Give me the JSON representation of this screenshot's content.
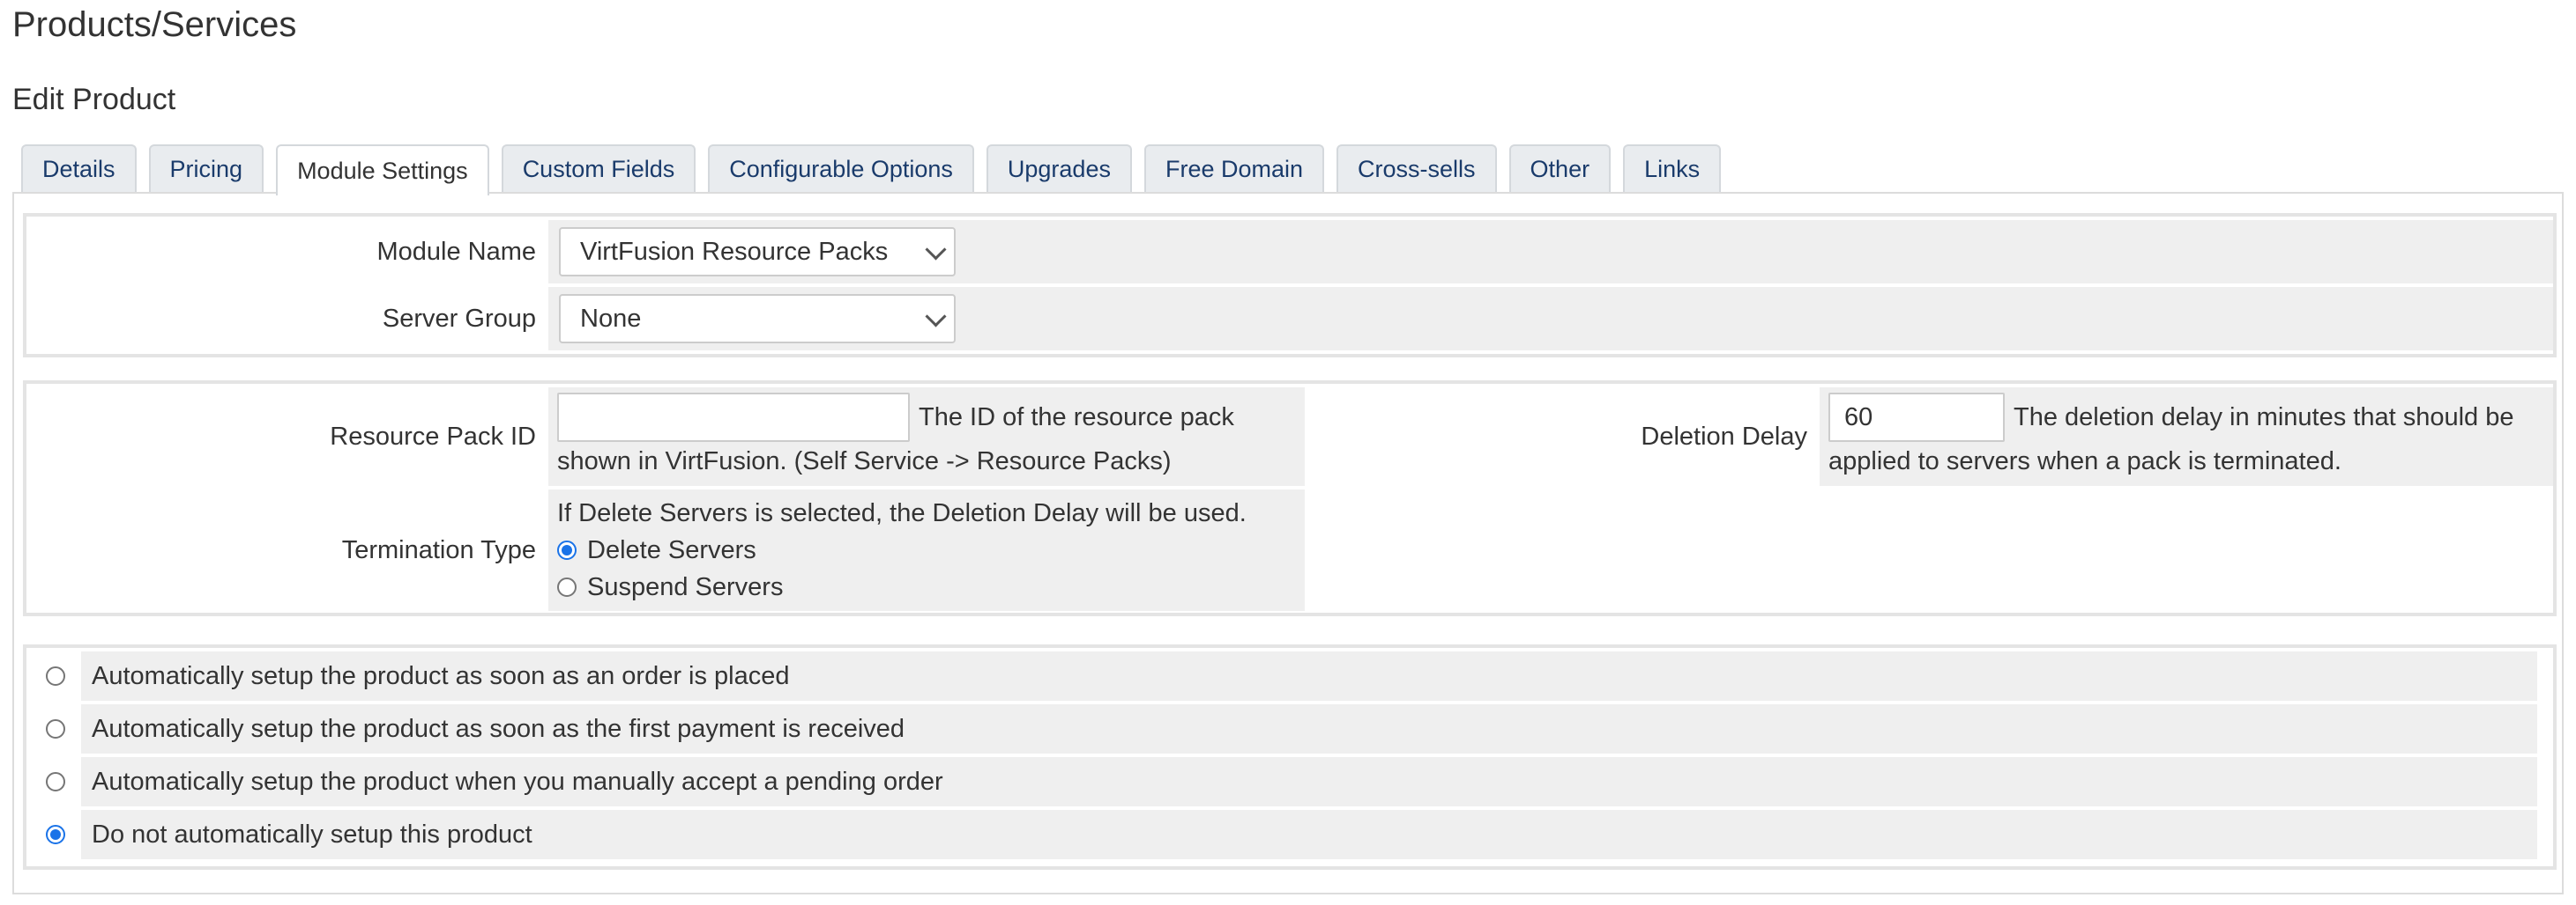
{
  "header": {
    "title": "Products/Services",
    "subtitle": "Edit Product"
  },
  "tabs": [
    {
      "label": "Details",
      "active": false
    },
    {
      "label": "Pricing",
      "active": false
    },
    {
      "label": "Module Settings",
      "active": true
    },
    {
      "label": "Custom Fields",
      "active": false
    },
    {
      "label": "Configurable Options",
      "active": false
    },
    {
      "label": "Upgrades",
      "active": false
    },
    {
      "label": "Free Domain",
      "active": false
    },
    {
      "label": "Cross-sells",
      "active": false
    },
    {
      "label": "Other",
      "active": false
    },
    {
      "label": "Links",
      "active": false
    }
  ],
  "module": {
    "module_name_label": "Module Name",
    "module_name_value": "VirtFusion Resource Packs",
    "server_group_label": "Server Group",
    "server_group_value": "None"
  },
  "config": {
    "resource_pack_label": "Resource Pack ID",
    "resource_pack_value": "",
    "resource_pack_help_1": "The ID of the resource pack",
    "resource_pack_help_2": "shown in VirtFusion. (Self Service -> Resource Packs)",
    "deletion_delay_label": "Deletion Delay",
    "deletion_delay_value": "60",
    "deletion_delay_help_1": "The deletion delay in minutes that should be",
    "deletion_delay_help_2": "applied to servers when a pack is terminated.",
    "termination_label": "Termination Type",
    "termination_help": "If Delete Servers is selected, the Deletion Delay will be used.",
    "termination_options": [
      {
        "label": "Delete Servers",
        "checked": true
      },
      {
        "label": "Suspend Servers",
        "checked": false
      }
    ]
  },
  "setup_options": [
    {
      "label": "Automatically setup the product as soon as an order is placed",
      "checked": false
    },
    {
      "label": "Automatically setup the product as soon as the first payment is received",
      "checked": false
    },
    {
      "label": "Automatically setup the product when you manually accept a pending order",
      "checked": false
    },
    {
      "label": "Do not automatically setup this product",
      "checked": true
    }
  ],
  "colors": {
    "accent": "#1a73e8",
    "tab_text": "#1a3b6b",
    "cell_bg": "#efefef"
  }
}
